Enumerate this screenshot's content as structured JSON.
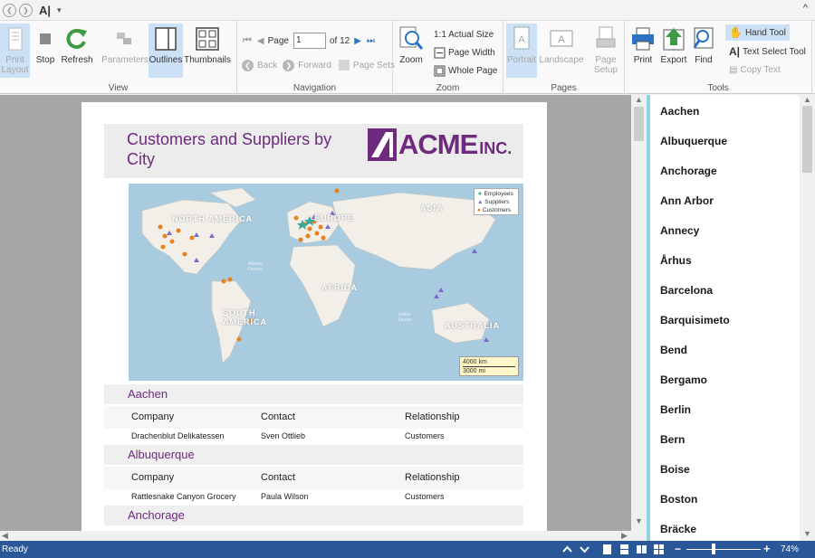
{
  "qat": {
    "app_icon_text": "A|",
    "collapse": "^"
  },
  "ribbon": {
    "view": {
      "label": "View",
      "print_layout": "Print Layout",
      "stop": "Stop",
      "refresh": "Refresh",
      "parameters": "Parameters",
      "outlines": "Outlines",
      "thumbnails": "Thumbnails"
    },
    "navigation": {
      "label": "Navigation",
      "page_label": "Page",
      "page_value": "1",
      "of_label": "of 12",
      "back": "Back",
      "forward": "Forward",
      "page_sets": "Page Sets"
    },
    "zoom": {
      "label": "Zoom",
      "zoom": "Zoom",
      "actual_size": "1:1 Actual Size",
      "page_width": "Page Width",
      "whole_page": "Whole Page"
    },
    "pages": {
      "label": "Pages",
      "portrait": "Portrait",
      "landscape": "Landscape",
      "page_setup": "Page Setup"
    },
    "tools": {
      "label": "Tools",
      "print": "Print",
      "export": "Export",
      "find": "Find",
      "hand_tool": "Hand Tool",
      "text_select_tool": "Text Select Tool",
      "copy_text": "Copy Text"
    }
  },
  "report": {
    "title": "Customers and Suppliers by City",
    "logo_main": "ACME",
    "logo_sub": "INC.",
    "map": {
      "legend": [
        "Employees",
        "Suppliers",
        "Customers"
      ],
      "scale": [
        "4000 km",
        "3000 mi"
      ],
      "labels": {
        "north_america": "NORTH AMERICA",
        "south_america": "SOUTH AMERICA",
        "europe": "EUROPE",
        "asia": "ASIA",
        "africa": "AFRICA",
        "australia": "AUSTRALIA",
        "atlantic": "Atlantic Ocean",
        "indian": "Indian Ocean"
      },
      "colors": {
        "employees": "#3aa89a",
        "suppliers": "#7b68c8",
        "customers": "#e8821e",
        "water": "#a9cbe0",
        "land": "#f2efe9"
      }
    },
    "columns": {
      "company": "Company",
      "contact": "Contact",
      "relationship": "Relationship"
    },
    "groups": [
      {
        "city": "Aachen",
        "rows": [
          {
            "company": "Drachenblut Delikatessen",
            "contact": "Sven Ottlieb",
            "relationship": "Customers"
          }
        ]
      },
      {
        "city": "Albuquerque",
        "rows": [
          {
            "company": "Rattlesnake Canyon Grocery",
            "contact": "Paula Wilson",
            "relationship": "Customers"
          }
        ]
      },
      {
        "city": "Anchorage",
        "rows": []
      }
    ]
  },
  "toc": {
    "items": [
      "Aachen",
      "Albuquerque",
      "Anchorage",
      "Ann Arbor",
      "Annecy",
      "Århus",
      "Barcelona",
      "Barquisimeto",
      "Bend",
      "Bergamo",
      "Berlin",
      "Bern",
      "Boise",
      "Boston",
      "Bräcke"
    ]
  },
  "status": {
    "text": "Ready",
    "zoom": "74%"
  }
}
